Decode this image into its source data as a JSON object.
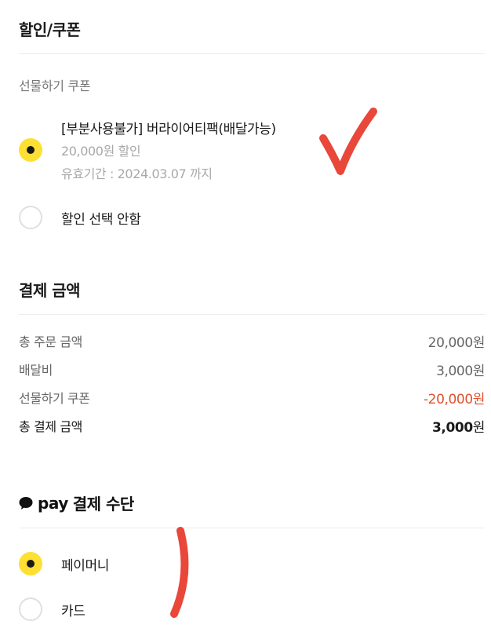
{
  "discount": {
    "title": "할인/쿠폰",
    "gift_coupon_label": "선물하기 쿠폰",
    "coupon": {
      "name": "[부분사용불가] 버라이어티팩(배달가능)",
      "amount": "20,000원 할인",
      "validity": "유효기간 : 2024.03.07 까지",
      "selected": true
    },
    "no_discount": {
      "label": "할인 선택 안함",
      "selected": false
    }
  },
  "payment_amount": {
    "title": "결제 금액",
    "rows": [
      {
        "label": "총 주문 금액",
        "value": "20,000원"
      },
      {
        "label": "배달비",
        "value": "3,000원"
      },
      {
        "label": "선물하기 쿠폰",
        "value": "-20,000원"
      }
    ],
    "total": {
      "label": "총 결제 금액",
      "value_number": "3,000",
      "value_unit": "원"
    }
  },
  "pay_method": {
    "brand": "pay",
    "title": "결제 수단",
    "options": [
      {
        "label": "페이머니",
        "selected": true
      },
      {
        "label": "카드",
        "selected": false
      }
    ]
  },
  "colors": {
    "radio_selected": "#fee033",
    "discount_text": "#e2502c",
    "annotation": "#e9473a"
  }
}
